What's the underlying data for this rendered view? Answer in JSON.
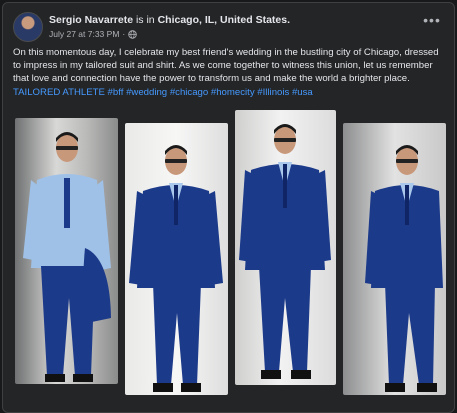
{
  "post": {
    "author": "Sergio Navarrete",
    "status_verb": "is in",
    "location": "Chicago, IL, United States.",
    "timestamp": "July 27 at 7:33 PM",
    "separator": "·",
    "body": "On this momentous day, I celebrate my best friend's wedding in the bustling city of Chicago, dressed to impress in my tailored suit and shirt. As we come together to witness this union, let us remember that love and connection have the power to transform us and make the world a brighter place.",
    "tags": [
      "TAILORED ATHLETE",
      "#bff",
      "#wedding",
      "#chicago",
      "#homecity",
      "#Illinois",
      "#usa"
    ],
    "more_label": "•••"
  },
  "colors": {
    "background": "#18191a",
    "card": "#242526",
    "text": "#e4e6eb",
    "secondary_text": "#b0b3b8",
    "link": "#4599ff",
    "suit": "#1c3a8a"
  },
  "icons": {
    "privacy": "globe-icon",
    "menu": "more-options-icon"
  }
}
